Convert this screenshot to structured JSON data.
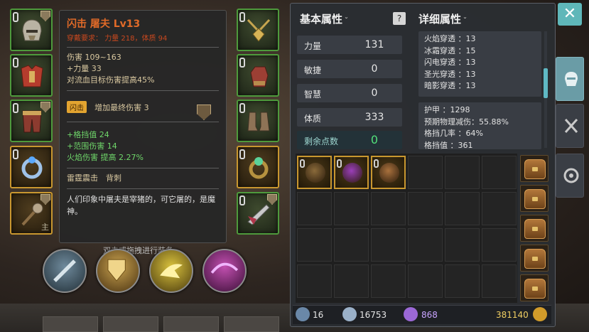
{
  "tooltip": {
    "title": "闪击 屠夫 Lv13",
    "requirement_label": "穿戴要求：",
    "requirement_value": "力量 218，体质 94",
    "base_lines": [
      "伤害 109~163",
      "+力量 33",
      "对流血目标伤害提高45%"
    ],
    "affix_badge": "闪击",
    "affix_text": "增加最终伤害 3",
    "bonus_lines": [
      "+格挡值 24",
      "+范围伤害 14",
      "火焰伤害 提高 2.27%"
    ],
    "set_names": "雷霆震击　背刺",
    "description": "人们印象中屠夫是宰猪的，可它屠的，是魔神。"
  },
  "equip_hint": "双击或拖拽进行装备",
  "left_slots": [
    {
      "icon": "helmet-icon",
      "sub": ""
    },
    {
      "icon": "chest-armor-icon",
      "sub": ""
    },
    {
      "icon": "leg-armor-icon",
      "sub": ""
    },
    {
      "icon": "ring-icon",
      "sub": ""
    },
    {
      "icon": "mace-icon",
      "sub": "主"
    }
  ],
  "right_slots": [
    {
      "icon": "amulet-icon"
    },
    {
      "icon": "gloves-icon"
    },
    {
      "icon": "boots-icon"
    },
    {
      "icon": "ring-icon"
    },
    {
      "icon": "offhand-weapon-icon"
    }
  ],
  "skills": [
    "blade-skill-icon",
    "shield-skill-icon",
    "strike-skill-icon",
    "arcane-skill-icon"
  ],
  "basic": {
    "header": "基本属性",
    "stats": [
      {
        "label": "力量",
        "value": "131"
      },
      {
        "label": "敏捷",
        "value": "0"
      },
      {
        "label": "智慧",
        "value": "0"
      },
      {
        "label": "体质",
        "value": "333"
      }
    ],
    "points_label": "剩余点数",
    "points_value": "0"
  },
  "detail": {
    "header": "详细属性",
    "resist_lines": [
      "火焰穿透 ：13",
      "冰霜穿透 ：15",
      "闪电穿透 ：13",
      "圣光穿透 ：13",
      "暗影穿透 ：13"
    ],
    "defense_lines": [
      "护甲 ：1298",
      "预期物理减伤：55.88%",
      "格挡几率 ：64%",
      "格挡值 ：361"
    ]
  },
  "inventory": {
    "items": [
      "pouch-item-icon",
      "purple-potion-icon",
      "staff-item-icon"
    ],
    "bags": 5
  },
  "status": {
    "level": "16",
    "soul": "16753",
    "gems": "868",
    "gold": "381140"
  },
  "help_label": "?",
  "close_label": "✕"
}
